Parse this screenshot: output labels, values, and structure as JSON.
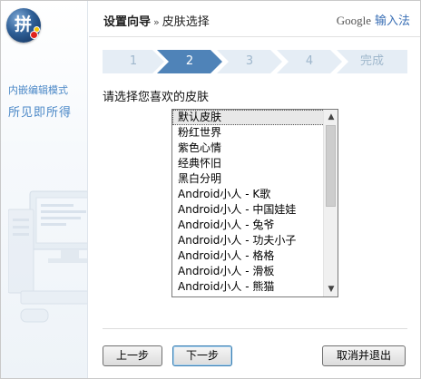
{
  "header": {
    "breadcrumb_main": "设置向导",
    "breadcrumb_sep": "»",
    "breadcrumb_current": "皮肤选择",
    "brand_google": "Google",
    "brand_ime": "输入法"
  },
  "sidebar": {
    "logo_glyph": "拼",
    "mode_title": "内嵌编辑模式",
    "mode_subtitle": "所见即所得"
  },
  "steps": {
    "items": [
      "1",
      "2",
      "3",
      "4",
      "完成"
    ],
    "active_index": 1
  },
  "main": {
    "prompt": "请选择您喜欢的皮肤",
    "skins": [
      "默认皮肤",
      "粉红世界",
      "紫色心情",
      "经典怀旧",
      "黑白分明",
      "Android小人 - K歌",
      "Android小人 - 中国娃娃",
      "Android小人 - 兔爷",
      "Android小人 - 功夫小子",
      "Android小人 - 格格",
      "Android小人 - 滑板",
      "Android小人 - 熊猫"
    ],
    "selected_skin": "默认皮肤"
  },
  "buttons": {
    "prev": "上一步",
    "next": "下一步",
    "cancel": "取消并退出"
  },
  "colors": {
    "accent": "#4f83b8",
    "step_inactive": "#e5edf5",
    "sidebar_text": "#4b88c7"
  }
}
